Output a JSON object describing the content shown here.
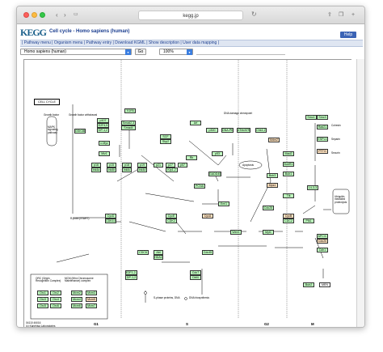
{
  "browser": {
    "address": "kegg.jp"
  },
  "header": {
    "logo": "KEGG",
    "title": "Cell cycle - Homo sapiens (human)",
    "help_label": "Help",
    "menu": "| Pathway menu | Organism menu | Pathway entry | Download KGML | Show description | User data mapping |"
  },
  "controls": {
    "organism": "Homo sapiens (human)",
    "go_label": "Go",
    "zoom": "100%"
  },
  "map": {
    "title": "CELL CYCLE",
    "phases": [
      "G1",
      "S",
      "G2",
      "M"
    ],
    "footer_lines": [
      "04110 4/6/16",
      "(c) Kanehisa Laboratories"
    ],
    "labels": [
      "Growth factor",
      "Growth factor withdrawal",
      "MAPK signaling pathway",
      "DNA damage checkpoint",
      "Cohesin",
      "Separin",
      "Securin",
      "R-point (START)",
      "Apoptosis",
      "Ubiquitin mediated proteolysis",
      "S-phase proteins, DNA",
      "DNA biosynthesis",
      "ORC (Origin Recognition Complex)",
      "MCM (Mini-Chromosome Maintenance) complex"
    ],
    "genes_green": [
      "TGFB",
      "Smad2,3",
      "Smad4",
      "p107",
      "E2F4,5",
      "DP-1,2",
      "GSK3B",
      "c-Myc",
      "Miz1",
      "Arf",
      "SCF",
      "Skp2",
      "Rb",
      "p15",
      "p16",
      "p18",
      "p19",
      "Ink4a",
      "Ink4b",
      "Ink4c",
      "Ink4d",
      "p21",
      "p27",
      "p57",
      "Kip1,2",
      "p300",
      "DNA-PK",
      "ATM/ATR",
      "Chk1,2",
      "p53",
      "Mdm2",
      "GADD45",
      "PCNA",
      "Smc1",
      "Smc3",
      "Rad21",
      "ESPL1",
      "Bub1",
      "14-3-3",
      "Mad2",
      "BubR1",
      "CycD",
      "CDK4,6",
      "CycE",
      "CDK2",
      "CycA",
      "CDC6",
      "Cdc45",
      "Cdc7",
      "Dbf4",
      "Abl",
      "HDAC",
      "E2F1,2,3",
      "DP-1,2",
      "CycB",
      "CDC2",
      "Plk1",
      "Wee1",
      "Myt1",
      "Cdc25",
      "Bub2",
      "Bub3",
      "Mps1",
      "APC/C",
      "Cdc20",
      "Cdh1",
      "MEN",
      "Orc1",
      "Orc2",
      "Orc3",
      "Orc4",
      "Orc5",
      "Orc6",
      "Mcm2",
      "Mcm3",
      "Mcm4",
      "Mcm5",
      "Mcm6",
      "Mcm7",
      "Ttk",
      "Emi1",
      "PTTG"
    ]
  }
}
